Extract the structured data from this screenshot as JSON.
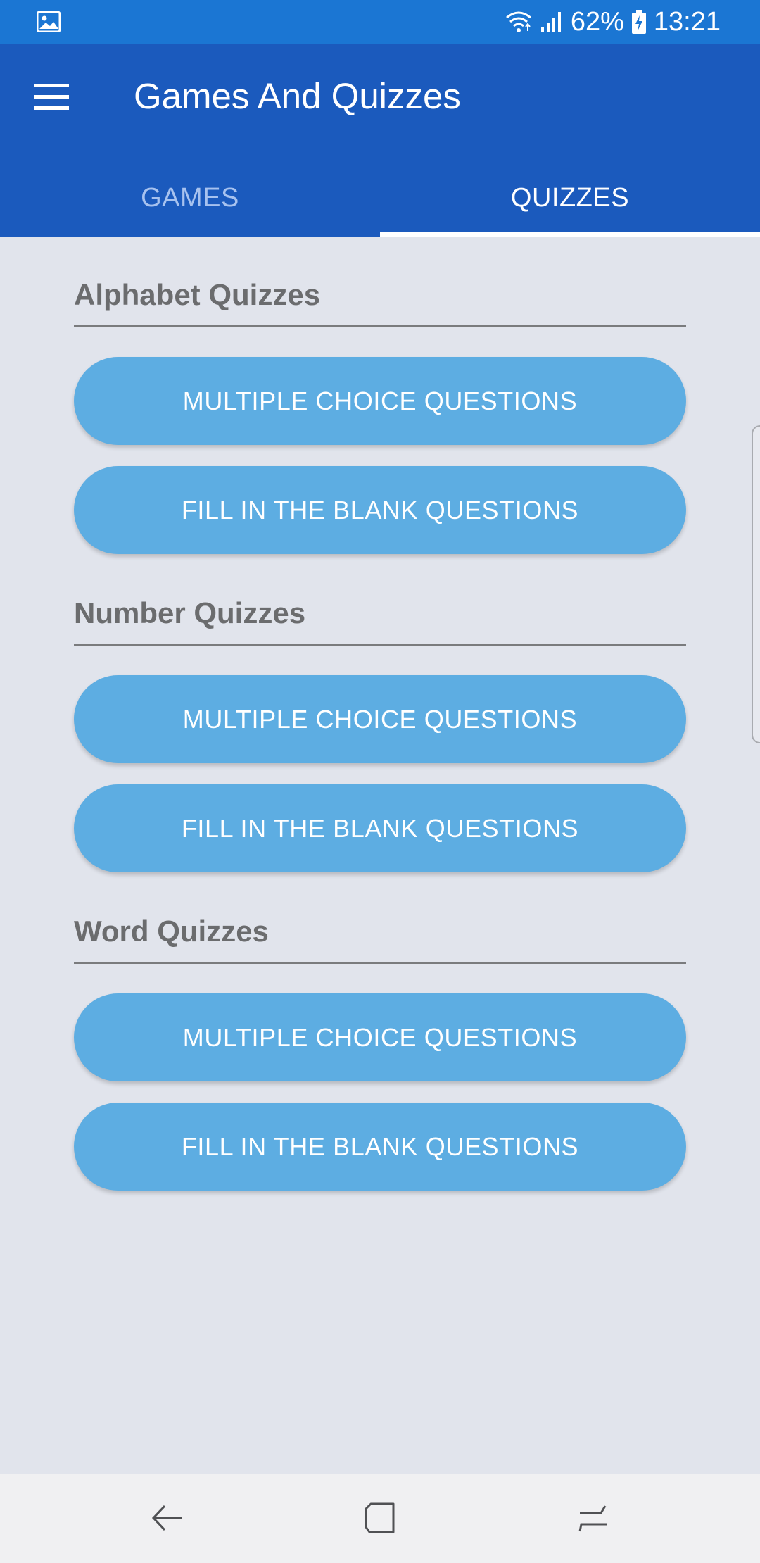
{
  "status_bar": {
    "battery": "62%",
    "time": "13:21",
    "icons": [
      "gallery-icon",
      "wifi-icon",
      "signal-icon",
      "battery-icon"
    ]
  },
  "app_bar": {
    "title": "Games And Quizzes",
    "menu_icon": "menu-icon",
    "color": "#1b5abd"
  },
  "tabs": [
    {
      "label": "GAMES",
      "selected": false
    },
    {
      "label": "QUIZZES",
      "selected": true
    }
  ],
  "sections": [
    {
      "heading": "Alphabet Quizzes",
      "buttons": [
        "MULTIPLE CHOICE QUESTIONS",
        "FILL IN THE BLANK QUESTIONS"
      ]
    },
    {
      "heading": "Number Quizzes",
      "buttons": [
        "MULTIPLE CHOICE QUESTIONS",
        "FILL IN THE BLANK QUESTIONS"
      ]
    },
    {
      "heading": "Word Quizzes",
      "buttons": [
        "MULTIPLE CHOICE QUESTIONS",
        "FILL IN THE BLANK QUESTIONS"
      ]
    }
  ],
  "colors": {
    "status_bar": "#1b76d3",
    "button": "#5dade2",
    "background": "#e1e4ec",
    "heading_text": "#6b6c6e"
  },
  "nav_bar": {
    "icons": [
      "back-icon",
      "home-icon",
      "recents-icon"
    ]
  }
}
